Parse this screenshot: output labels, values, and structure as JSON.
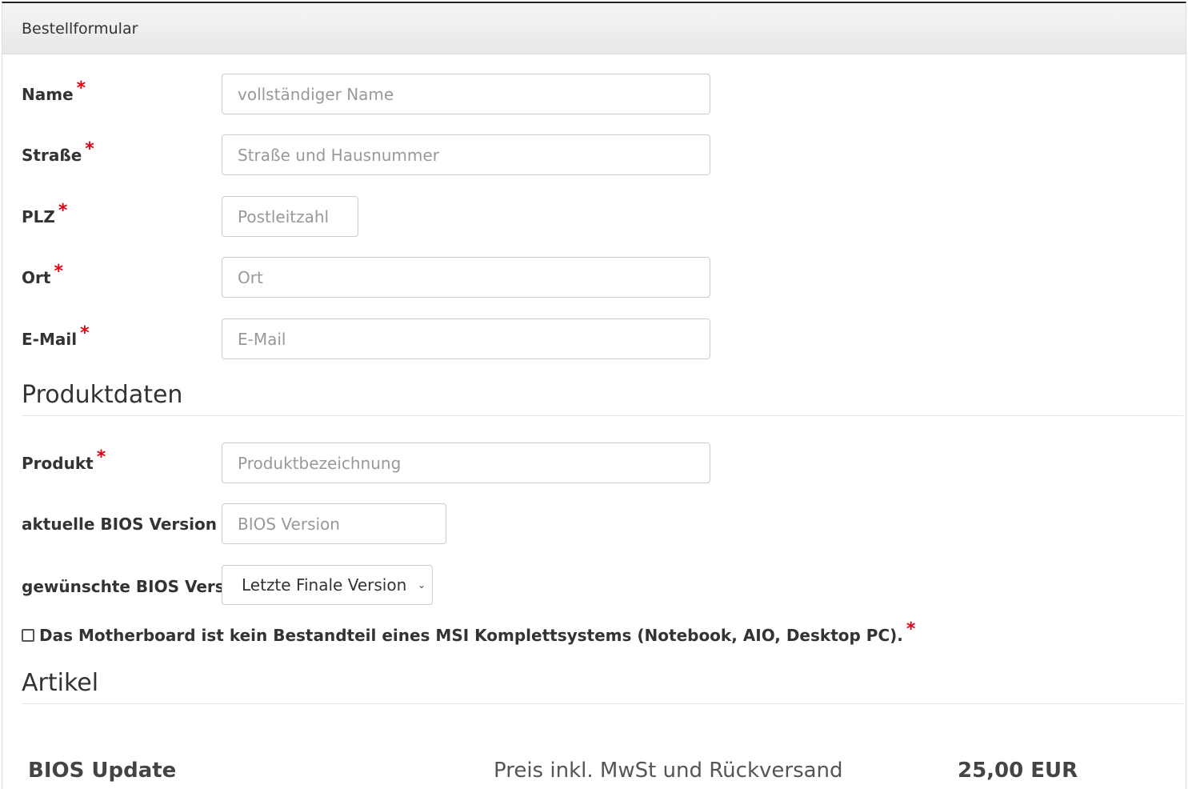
{
  "panel": {
    "title": "Bestellformular"
  },
  "fields": {
    "name": {
      "label": "Name",
      "placeholder": "vollständiger Name"
    },
    "strasse": {
      "label": "Straße",
      "placeholder": "Straße und Hausnummer"
    },
    "plz": {
      "label": "PLZ",
      "placeholder": "Postleitzahl"
    },
    "ort": {
      "label": "Ort",
      "placeholder": "Ort"
    },
    "email": {
      "label": "E-Mail",
      "placeholder": "E-Mail"
    }
  },
  "required_marker": "*",
  "produktdaten": {
    "heading": "Produktdaten",
    "produkt": {
      "label": "Produkt",
      "placeholder": "Produktbezeichnung"
    },
    "bios_current": {
      "label": "aktuelle BIOS Version",
      "placeholder": "BIOS Version"
    },
    "bios_wanted": {
      "label": "gewünschte BIOS Version",
      "selected": "Letzte Finale Version"
    },
    "checkbox_label": "Das Motherboard ist kein Bestandteil eines MSI Komplettsystems (Notebook, AIO, Desktop PC)."
  },
  "artikel": {
    "heading": "Artikel",
    "item_name": "BIOS Update",
    "price_note": "Preis inkl. MwSt und Rückversand",
    "price": "25,00 EUR"
  }
}
